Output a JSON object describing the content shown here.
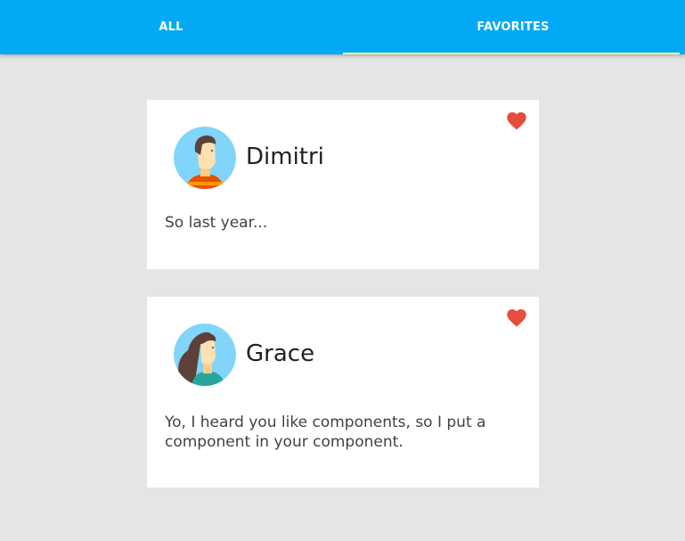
{
  "tabs": [
    {
      "label": "ALL",
      "active": false
    },
    {
      "label": "FAVORITES",
      "active": true
    }
  ],
  "colors": {
    "tab_bar": "#03a9f4",
    "ink_bar": "#ffff8d",
    "heart": "#e74c3c",
    "background": "#e5e5e5"
  },
  "cards": [
    {
      "name": "Dimitri",
      "message": "So last year...",
      "favorite": true,
      "avatar_icon": "avatar-man-icon",
      "heart_icon": "heart-icon"
    },
    {
      "name": "Grace",
      "message": "Yo, I heard you like components, so I put a component in your component.",
      "favorite": true,
      "avatar_icon": "avatar-woman-icon",
      "heart_icon": "heart-icon"
    }
  ]
}
